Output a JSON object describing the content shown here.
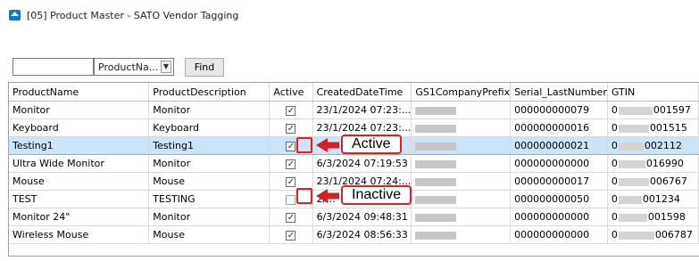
{
  "window": {
    "title": "[05] Product Master - SATO Vendor Tagging"
  },
  "toolbar": {
    "search_value": "",
    "field_select_value": "ProductNa...",
    "find_label": "Find"
  },
  "grid": {
    "columns": [
      "ProductName",
      "ProductDescription",
      "Active",
      "CreatedDateTime",
      "GS1CompanyPrefix",
      "Serial_LastNumber",
      "GTIN"
    ],
    "rows": [
      {
        "name": "Monitor",
        "desc": "Monitor",
        "active": true,
        "created": "23/1/2024 07:23:...",
        "serial": "000000000079",
        "gtin_start": "0",
        "gtin_end": "001597"
      },
      {
        "name": "Keyboard",
        "desc": "Keyboard",
        "active": true,
        "created": "23/1/2024 07:23:...",
        "serial": "000000000016",
        "gtin_start": "0",
        "gtin_end": "001515"
      },
      {
        "name": "Testing1",
        "desc": "Testing1",
        "active": true,
        "created": "",
        "serial": "000000000021",
        "gtin_start": "0",
        "gtin_end": "002112",
        "selected": true
      },
      {
        "name": "Ultra Wide Monitor",
        "desc": "Monitor",
        "active": true,
        "created": "6/3/2024 07:19:53",
        "serial": "000000000000",
        "gtin_start": "0",
        "gtin_end": "016990"
      },
      {
        "name": "Mouse",
        "desc": "Mouse",
        "active": true,
        "created": "23/1/2024 07:24:...",
        "serial": "000000000017",
        "gtin_start": "0",
        "gtin_end": "006767"
      },
      {
        "name": "TEST",
        "desc": "TESTING",
        "active": false,
        "created": "2/...",
        "serial": "000000000050",
        "gtin_start": "0",
        "gtin_end": "001234"
      },
      {
        "name": "Monitor 24\"",
        "desc": "Monitor",
        "active": true,
        "created": "6/3/2024 09:48:31",
        "serial": "000000000000",
        "gtin_start": "0",
        "gtin_end": "001598"
      },
      {
        "name": "Wireless Mouse",
        "desc": "Mouse",
        "active": true,
        "created": "6/3/2024 08:56:33",
        "serial": "000000000000",
        "gtin_start": "0",
        "gtin_end": "006787"
      }
    ]
  },
  "annotations": {
    "active_label": "Active",
    "inactive_label": "Inactive",
    "accent_color": "#e02020"
  }
}
